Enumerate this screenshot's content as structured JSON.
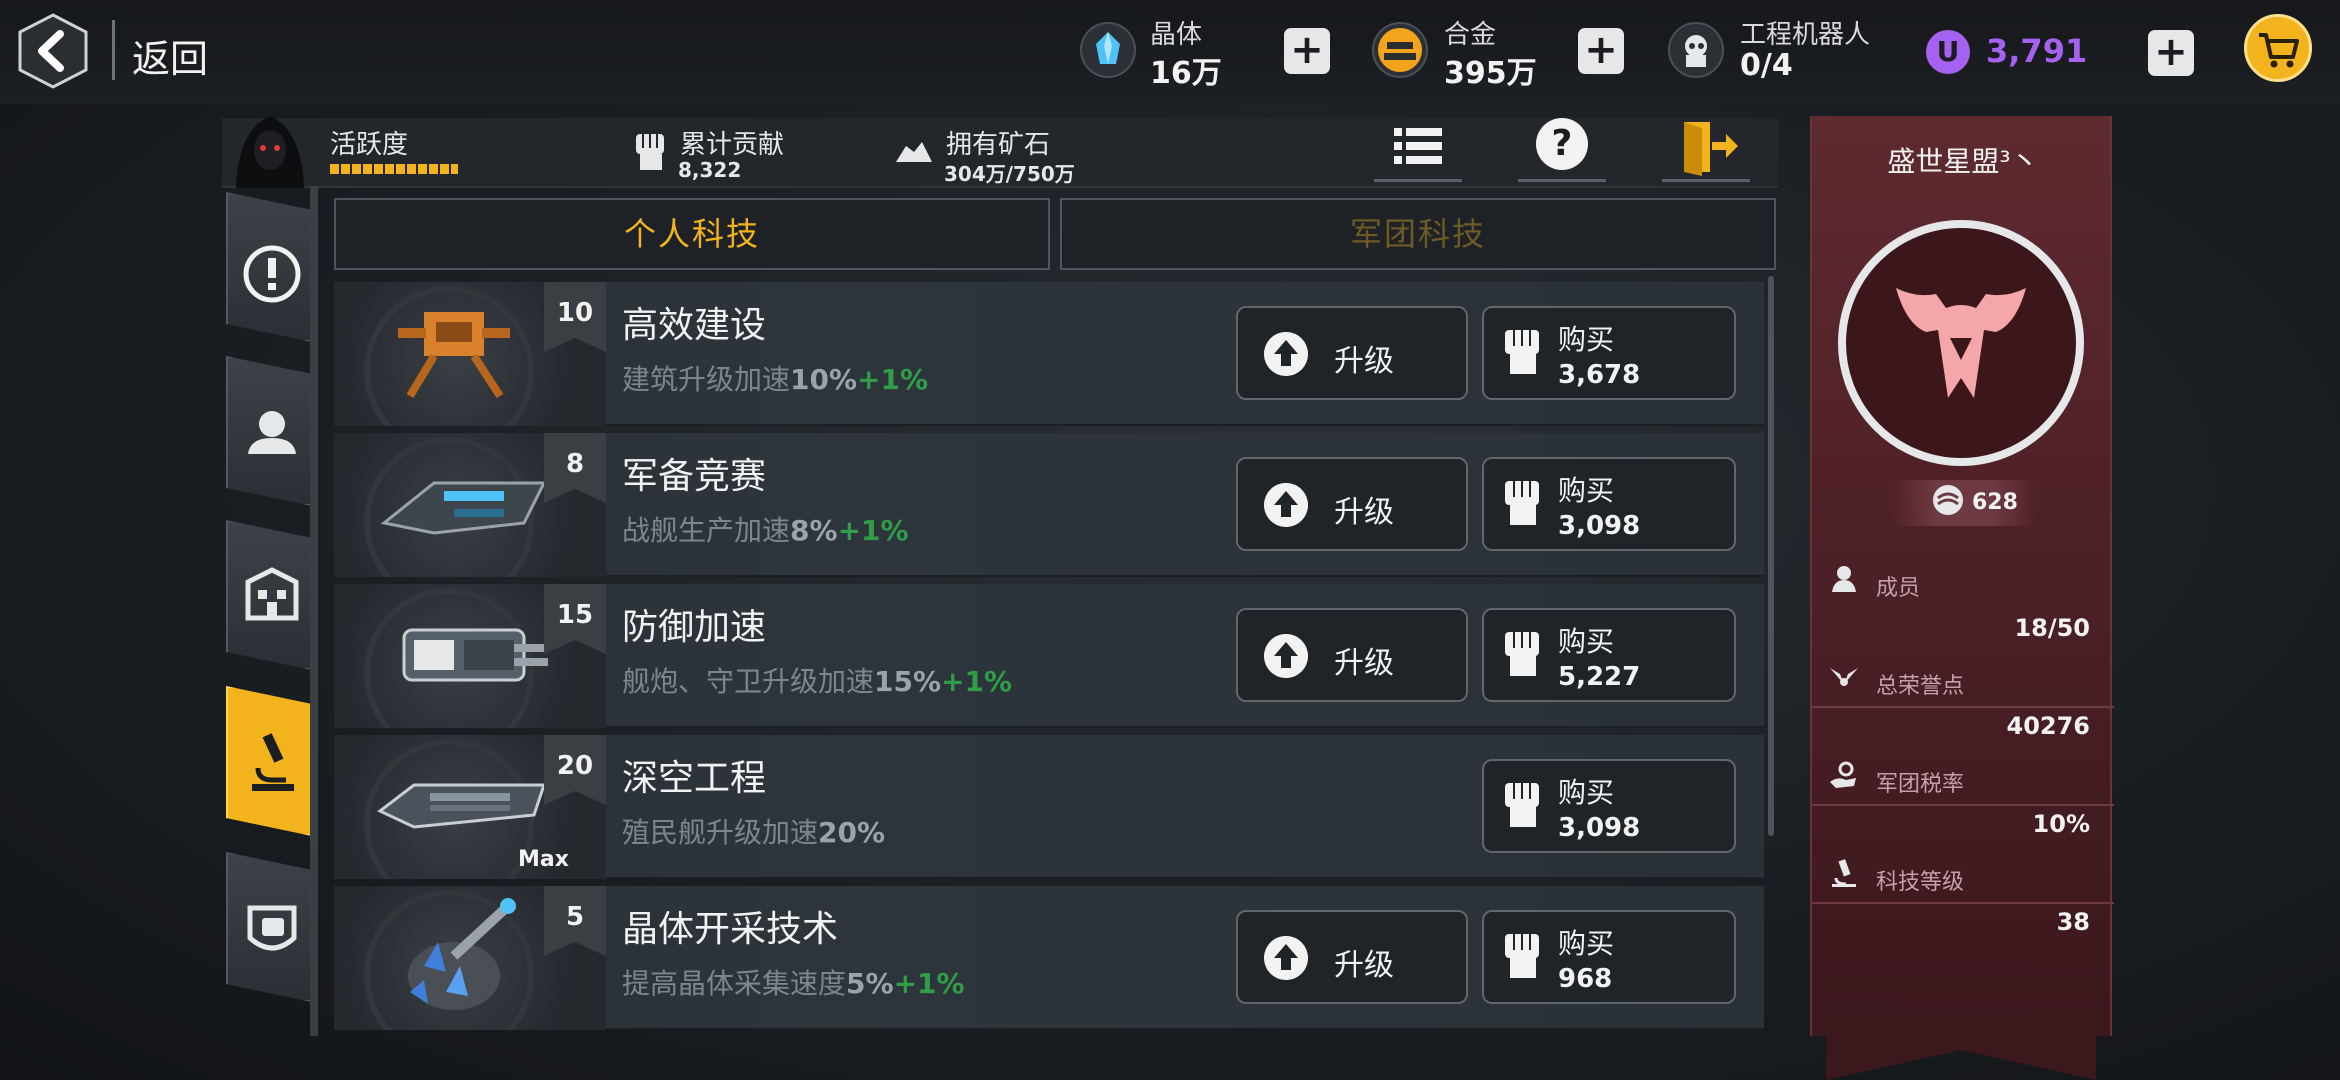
{
  "topbar": {
    "back_label": "返回",
    "resources": [
      {
        "title": "晶体",
        "value": "16万",
        "icon": "crystal-icon"
      },
      {
        "title": "合金",
        "value": "395万",
        "icon": "alloy-icon"
      },
      {
        "title": "工程机器人",
        "value": "0/4",
        "icon": "robot-icon"
      }
    ],
    "premium_value": "3,791",
    "premium_icon_letter": "U"
  },
  "header": {
    "activity_label": "活跃度",
    "contribution_label": "累计贡献",
    "contribution_value": "8,322",
    "ore_label": "拥有矿石",
    "ore_value": "304万/750万",
    "help_glyph": "?"
  },
  "tabs": [
    {
      "label": "个人科技",
      "active": true
    },
    {
      "label": "军团科技",
      "active": false
    }
  ],
  "techs": [
    {
      "name": "高效建设",
      "desc": "建筑升级加速",
      "value": "10%",
      "bonus": "+1%",
      "level": "10",
      "upgrade_label": "升级",
      "buy_label": "购买",
      "price": "3,678",
      "max": false
    },
    {
      "name": "军备竞赛",
      "desc": "战舰生产加速",
      "value": "8%",
      "bonus": "+1%",
      "level": "8",
      "upgrade_label": "升级",
      "buy_label": "购买",
      "price": "3,098",
      "max": false
    },
    {
      "name": "防御加速",
      "desc": "舰炮、守卫升级加速",
      "value": "15%",
      "bonus": "+1%",
      "level": "15",
      "upgrade_label": "升级",
      "buy_label": "购买",
      "price": "5,227",
      "max": false
    },
    {
      "name": "深空工程",
      "desc": "殖民舰升级加速",
      "value": "20%",
      "bonus": "",
      "level": "20",
      "upgrade_label": "",
      "buy_label": "购买",
      "price": "3,098",
      "max": true,
      "max_label": "Max"
    },
    {
      "name": "晶体开采技术",
      "desc": "提高晶体采集速度",
      "value": "5%",
      "bonus": "+1%",
      "level": "5",
      "upgrade_label": "升级",
      "buy_label": "购买",
      "price": "968",
      "max": false
    }
  ],
  "alliance": {
    "name": "盛世星盟³丶",
    "badge_value": "628",
    "stats": [
      {
        "label": "成员",
        "value": "18/50",
        "icon": "members-icon"
      },
      {
        "label": "总荣誉点",
        "value": "40276",
        "icon": "wings-icon"
      },
      {
        "label": "军团税率",
        "value": "10%",
        "icon": "tax-icon"
      },
      {
        "label": "科技等级",
        "value": "38",
        "icon": "microscope-icon"
      }
    ]
  },
  "colors": {
    "accent": "#f2b31c",
    "premium": "#a561f0",
    "bonus": "#2f9e47",
    "alliance_panel": "#4a1f25"
  }
}
